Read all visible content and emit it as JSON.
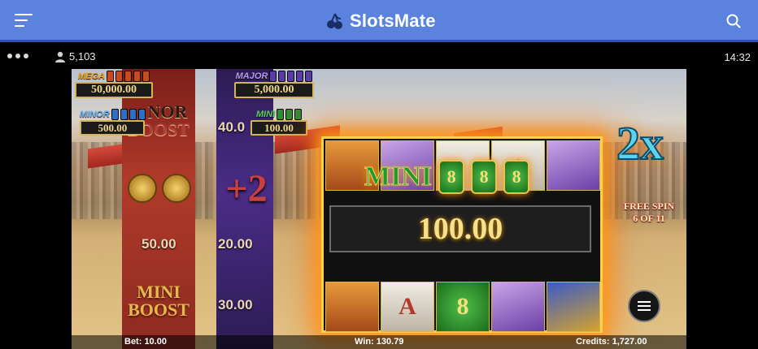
{
  "header": {
    "brand": "SlotsMate",
    "colors": {
      "bar": "#5b83de",
      "accent": "#2f54b0"
    }
  },
  "infobar": {
    "players": "5,103",
    "time": "14:32"
  },
  "jackpots": {
    "mega": {
      "label": "MEGA",
      "amount": "50,000.00"
    },
    "major": {
      "label": "MAJOR",
      "amount": "5,000.00"
    },
    "minor": {
      "label": "MINOR",
      "amount": "500.00"
    },
    "mini": {
      "label": "MINI",
      "amount": "100.00"
    }
  },
  "columns": {
    "red": {
      "boost_top": "BOOST",
      "boost_top_partial": "NOR",
      "value_mid": "50.00",
      "boost_bottom_1": "MINI",
      "boost_bottom_2": "BOOST"
    },
    "purple": {
      "value_top": "40.0",
      "plus": "+2",
      "value_mid": "20.00",
      "value_bottom": "30.00"
    }
  },
  "reels": {
    "mini_word": "MINI",
    "mini_cells": [
      "8",
      "8",
      "8"
    ],
    "win_amount": "100.00",
    "symbol_a": "A",
    "symbol_coin": "8"
  },
  "multiplier": "2x",
  "free_spin": {
    "line1": "FREE SPIN",
    "line2": "6 OF 11"
  },
  "status": {
    "bet": "Bet: 10.00",
    "win": "Win: 130.79",
    "credits": "Credits: 1,727.00"
  }
}
